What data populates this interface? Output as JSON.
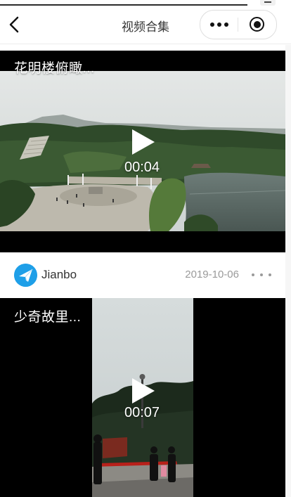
{
  "navbar": {
    "title": "视频合集",
    "back_icon": "chevron-left-icon",
    "more_icon": "more-dots-icon",
    "close_icon": "target-icon"
  },
  "videos": [
    {
      "title": "花明楼俯瞰...",
      "duration": "00:04",
      "author": "Jianbo",
      "avatar_icon": "paper-plane-icon",
      "date": "2019-10-06",
      "more_icon": "more-horizontal-icon"
    },
    {
      "title": "少奇故里...",
      "duration": "00:07"
    }
  ],
  "colors": {
    "accent_avatar": "#1e9fe8",
    "card_background": "#000000",
    "text_muted": "#9a9a9a"
  }
}
